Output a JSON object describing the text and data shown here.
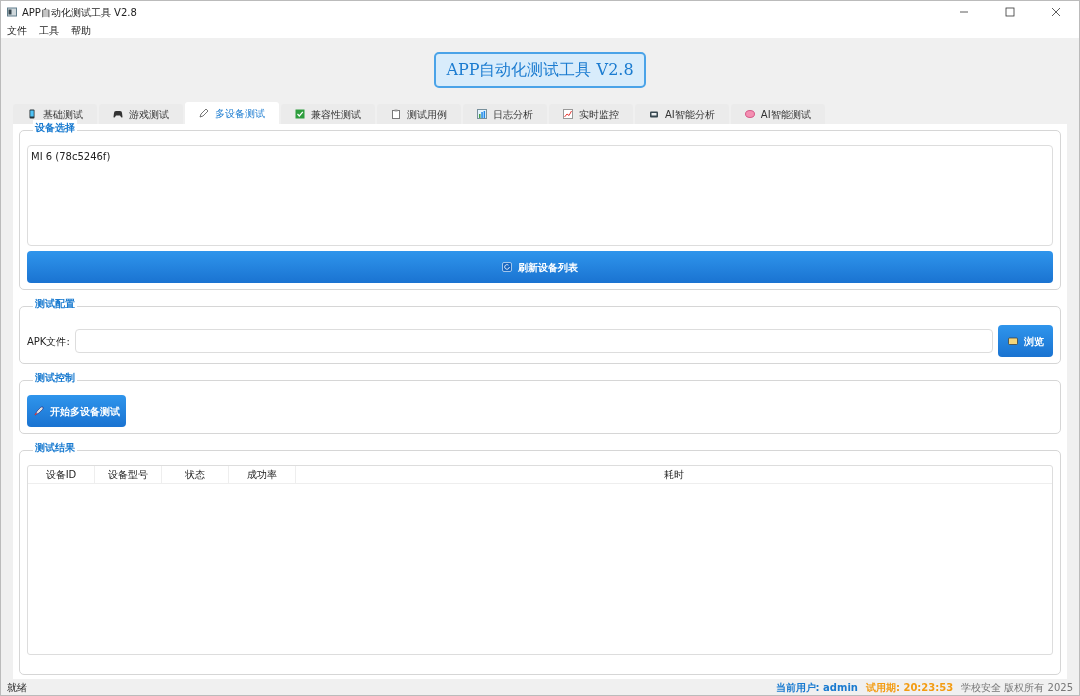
{
  "window": {
    "title": "APP自动化测试工具 V2.8"
  },
  "menu": [
    "文件",
    "工具",
    "帮助"
  ],
  "header": {
    "title": "APP自动化测试工具 V2.8"
  },
  "tabs": [
    {
      "label": "基础测试",
      "selected": false
    },
    {
      "label": "游戏测试",
      "selected": false
    },
    {
      "label": "多设备测试",
      "selected": true
    },
    {
      "label": "兼容性测试",
      "selected": false
    },
    {
      "label": "测试用例",
      "selected": false
    },
    {
      "label": "日志分析",
      "selected": false
    },
    {
      "label": "实时监控",
      "selected": false
    },
    {
      "label": "AI智能分析",
      "selected": false
    },
    {
      "label": "AI智能测试",
      "selected": false
    }
  ],
  "device_group": {
    "title": "设备选择",
    "devices": [
      "MI 6 (78c5246f)"
    ],
    "refresh_button": "刷新设备列表"
  },
  "config_group": {
    "title": "测试配置",
    "apk_label": "APK文件:",
    "browse_button": "浏览"
  },
  "control_group": {
    "title": "测试控制",
    "start_button": "开始多设备测试"
  },
  "results_group": {
    "title": "测试结果",
    "table": {
      "columns": [
        "设备ID",
        "设备型号",
        "状态",
        "成功率",
        "耗时"
      ]
    }
  },
  "status_bar": {
    "message": "就绪",
    "user": "当前用户: admin",
    "trial": "试用期: 20:23:53",
    "copyright": "学校安全 版权所有 2025"
  }
}
